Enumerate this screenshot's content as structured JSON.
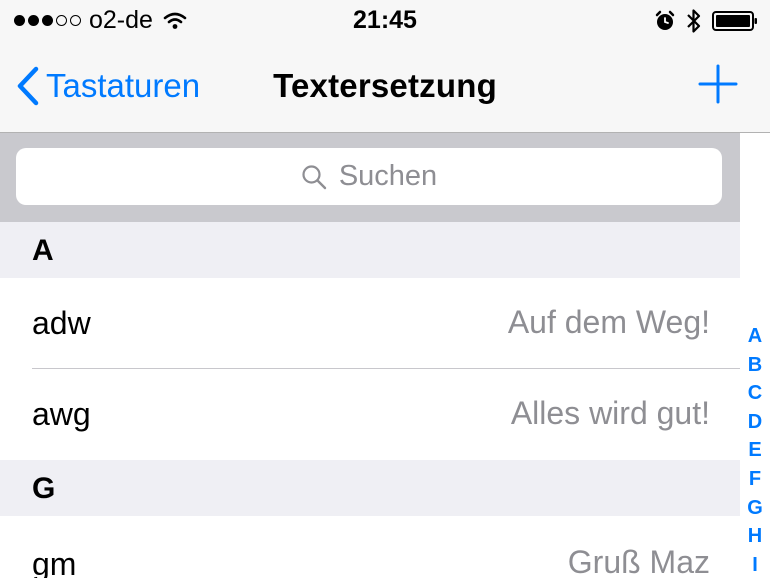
{
  "status_bar": {
    "carrier": "o2-de",
    "time": "21:45"
  },
  "nav": {
    "back_label": "Tastaturen",
    "title": "Textersetzung"
  },
  "search": {
    "placeholder": "Suchen"
  },
  "sections": [
    {
      "letter": "A",
      "rows": [
        {
          "shortcut": "adw",
          "phrase": "Auf dem Weg!"
        },
        {
          "shortcut": "awg",
          "phrase": "Alles wird gut!"
        }
      ]
    },
    {
      "letter": "G",
      "rows": [
        {
          "shortcut": "gm",
          "phrase": "Gruß Maz"
        }
      ]
    }
  ],
  "index": [
    "A",
    "B",
    "C",
    "D",
    "E",
    "F",
    "G",
    "H",
    "I"
  ],
  "colors": {
    "accent": "#007aff",
    "secondary_text": "#8e8e93",
    "section_bg": "#efeff4",
    "search_bg": "#c9c9ce"
  }
}
